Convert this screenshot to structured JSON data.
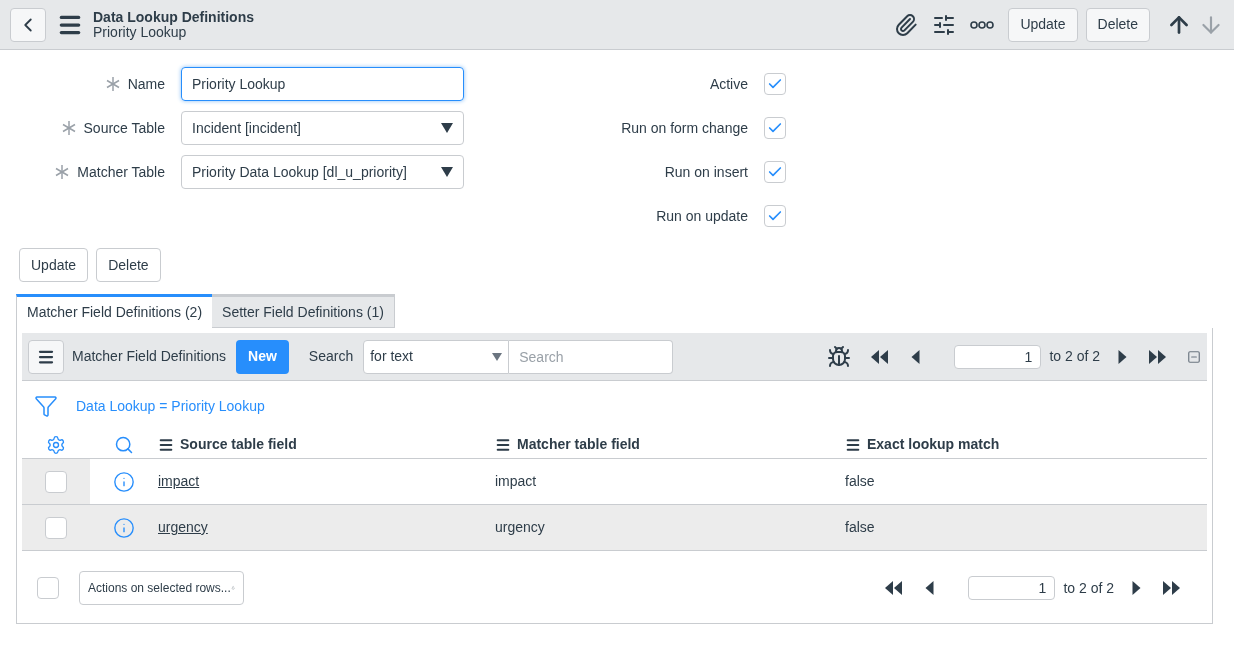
{
  "header": {
    "title": "Data Lookup Definitions",
    "subtitle": "Priority Lookup",
    "buttons": [
      "Update",
      "Delete"
    ]
  },
  "form": {
    "fields": [
      {
        "kind": "text",
        "label": "Name",
        "value": "Priority Lookup",
        "required": true,
        "focused": true
      },
      {
        "kind": "select",
        "label": "Source Table",
        "value": "Incident [incident]",
        "required": true,
        "focused": false
      },
      {
        "kind": "select",
        "label": "Matcher Table",
        "value": "Priority Data Lookup [dl_u_priority]",
        "required": true,
        "focused": false
      }
    ],
    "checkboxes": [
      {
        "label": "Active",
        "checked": true
      },
      {
        "label": "Run on form change",
        "checked": true
      },
      {
        "label": "Run on insert",
        "checked": true
      },
      {
        "label": "Run on update",
        "checked": true
      }
    ],
    "buttons": [
      "Update",
      "Delete"
    ]
  },
  "tabs": [
    {
      "label": "Matcher Field Definitions (2)",
      "selected": true
    },
    {
      "label": "Setter Field Definitions (1)",
      "selected": false
    }
  ],
  "list": {
    "title": "Matcher Field Definitions",
    "new_button": "New",
    "search_label": "Search",
    "search_mode": "for text",
    "search_placeholder": "Search",
    "page": "1",
    "range": "to 2 of 2",
    "filter": "Data Lookup = Priority Lookup",
    "columns": [
      "Source table field",
      "Matcher table field",
      "Exact lookup match"
    ],
    "rows": [
      {
        "checked": false,
        "cells": [
          "impact",
          "impact",
          "false"
        ]
      },
      {
        "checked": false,
        "cells": [
          "urgency",
          "urgency",
          "false"
        ]
      }
    ],
    "select_all_checked": false,
    "actions": "Actions on selected rows...",
    "footer_page": "1",
    "footer_range": "to 2 of 2"
  }
}
